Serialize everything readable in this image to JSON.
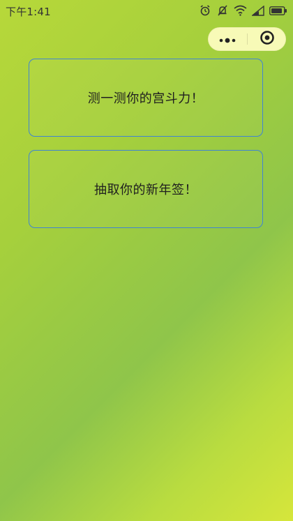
{
  "status_bar": {
    "time": "下午1:41",
    "icons": [
      "alarm-icon",
      "mute-icon",
      "wifi-icon",
      "signal-icon",
      "battery-icon"
    ]
  },
  "capsule": {
    "more_icon": "more-dots-icon",
    "close_icon": "target-close-icon"
  },
  "buttons": [
    {
      "label": "测一测你的宫斗力！"
    },
    {
      "label": "抽取你的新年签！"
    }
  ],
  "colors": {
    "button_border": "#3f84d3",
    "capsule_bg": "#fcfcbe",
    "text": "#1f1f1f"
  }
}
